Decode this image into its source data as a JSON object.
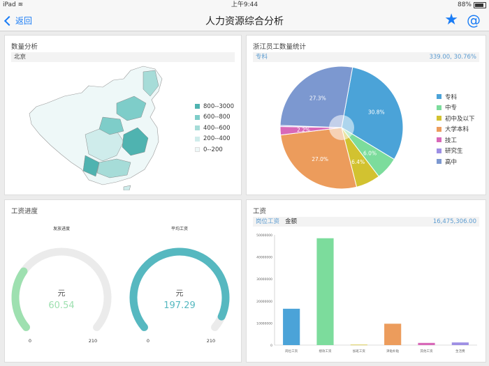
{
  "statusbar": {
    "device": "iPad",
    "time": "上午9:44",
    "battery": "88%"
  },
  "navbar": {
    "back_label": "返回",
    "title": "人力资源综合分析"
  },
  "quantity_panel": {
    "title": "数量分析",
    "selected_region": "北京",
    "legend": [
      {
        "label": "800--3000",
        "color": "#4fb3b0"
      },
      {
        "label": "600--800",
        "color": "#7ecdc9"
      },
      {
        "label": "400--600",
        "color": "#a6dcd8"
      },
      {
        "label": "200--400",
        "color": "#cfeceb"
      },
      {
        "label": "0--200",
        "color": "#eef8f8"
      }
    ]
  },
  "zhejiang_panel": {
    "title": "浙江员工数量统计",
    "selected_label": "专科",
    "selected_value": "339.00, 30.76%"
  },
  "progress_panel": {
    "title": "工资进度",
    "gauges": [
      {
        "title": "发放进度",
        "unit": "元",
        "value_text": "60.54",
        "value": 60.54,
        "min_label": "0",
        "max_label": "210",
        "max": 210,
        "color": "#9ee0b0"
      },
      {
        "title": "平均工资",
        "unit": "元",
        "value_text": "197.29",
        "value": 197.29,
        "min_label": "0",
        "max_label": "210",
        "max": 210,
        "color": "#56b8c0"
      }
    ]
  },
  "salary_panel": {
    "title": "工资",
    "tab_active": "岗位工资",
    "tab_other": "金额",
    "total": "16,475,306.00"
  },
  "chart_data": [
    {
      "type": "pie",
      "categories": [
        "专科",
        "中专",
        "初中及以下",
        "大学本科",
        "技工",
        "研究生",
        "高中"
      ],
      "values": [
        30.8,
        6.0,
        6.4,
        27.0,
        2.2,
        0.3,
        27.3
      ],
      "labels": [
        "30.8%",
        "6.0%",
        "6.4%",
        "27.0%",
        "2.2%",
        "",
        "27.3%"
      ],
      "colors": [
        "#4ba3d8",
        "#7cdc9c",
        "#d2c230",
        "#ec9c5c",
        "#d868b8",
        "#9d8fe4",
        "#7c98d0"
      ],
      "legend_position": "right"
    },
    {
      "type": "bar",
      "categories": [
        "岗位工资",
        "绩效工资",
        "加班工资",
        "津贴补贴",
        "其他工资",
        "生活费"
      ],
      "values": [
        16500000,
        48500000,
        200000,
        9700000,
        1000000,
        1200000
      ],
      "colors": [
        "#4ba3d8",
        "#7cdc9c",
        "#d2c230",
        "#ec9c5c",
        "#d868b8",
        "#9d8fe4"
      ],
      "ylim": [
        0,
        50000000
      ],
      "yticks": [
        "0",
        "10000000",
        "20000000",
        "30000000",
        "40000000",
        "50000000"
      ]
    }
  ]
}
